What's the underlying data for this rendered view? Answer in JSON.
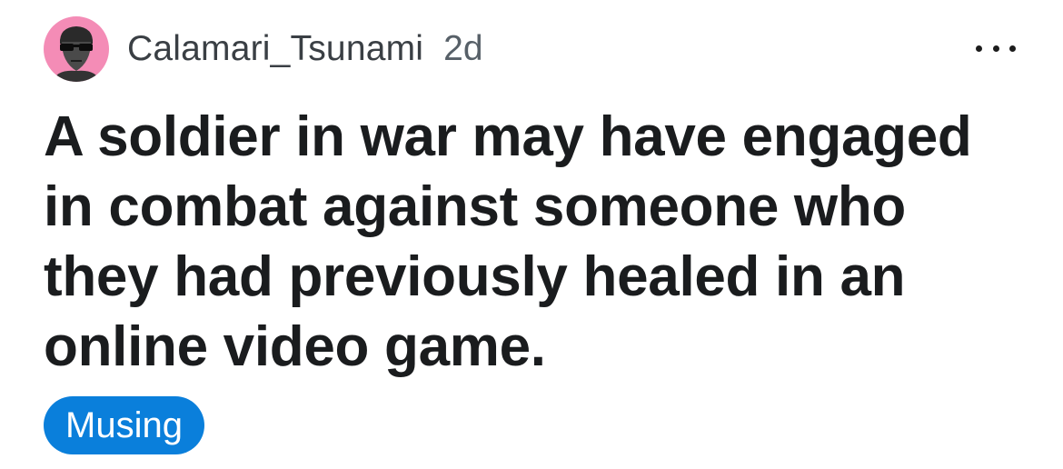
{
  "post": {
    "author": "Calamari_Tsunami",
    "age": "2d",
    "title": "A soldier in war may have engaged in combat against someone who they had previously healed in an online video game.",
    "flair": "Musing",
    "more_icon": "ellipsis-horizontal-icon"
  },
  "colors": {
    "avatar_bg": "#f48cb6",
    "flair_bg": "#0a7fdb",
    "title_text": "#1a1c1e",
    "meta_text": "#3a3f44"
  }
}
